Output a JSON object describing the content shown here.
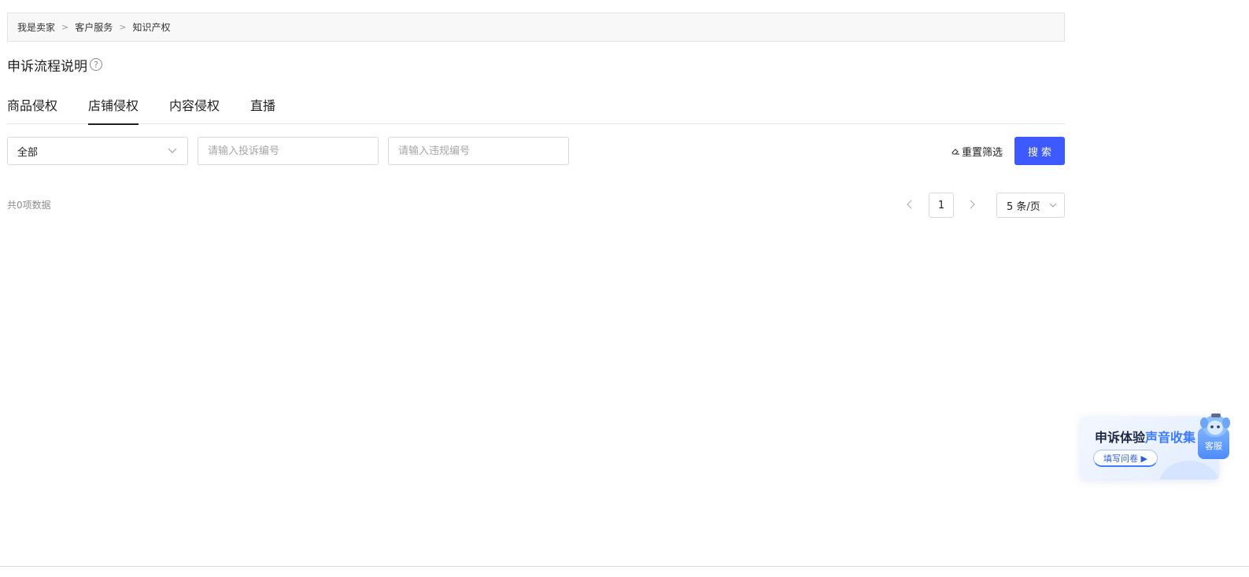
{
  "breadcrumb": {
    "items": [
      "我是卖家",
      "客户服务",
      "知识产权"
    ],
    "separator": ">"
  },
  "page": {
    "title": "申诉流程说明",
    "help_icon_glyph": "?"
  },
  "tabs": [
    {
      "label": "商品侵权",
      "active": false
    },
    {
      "label": "店铺侵权",
      "active": true
    },
    {
      "label": "内容侵权",
      "active": false
    },
    {
      "label": "直播",
      "active": false
    }
  ],
  "filters": {
    "type_select_value": "全部",
    "complaint_placeholder": "请输入投诉编号",
    "violation_placeholder": "请输入违规编号",
    "reset_label": "重置筛选",
    "search_label": "搜索"
  },
  "results": {
    "total_text": "共0项数据"
  },
  "pagination": {
    "current_page": "1",
    "page_size_label": "5 条/页"
  },
  "survey_card": {
    "title_prefix": "申诉体验",
    "title_highlight": "声音收集",
    "button_label": "填写问卷 ▶"
  },
  "customer_service": {
    "label": "客服"
  },
  "colors": {
    "primary": "#3d5afe",
    "accent_blue": "#3d7bff",
    "border": "#d9d9d9",
    "breadcrumb_bg": "#f8f8f8"
  }
}
